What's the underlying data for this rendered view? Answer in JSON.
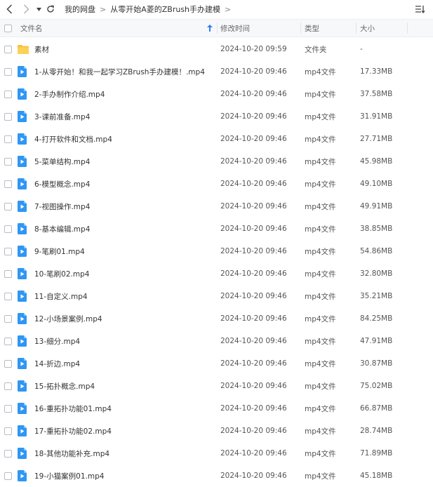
{
  "breadcrumb": {
    "items": [
      "我的网盘",
      "从零开始A菱的ZBrush手办建模"
    ],
    "separator": ">"
  },
  "header": {
    "name": "文件名",
    "modified": "修改时间",
    "type": "类型",
    "size": "大小"
  },
  "colors": {
    "header_bg": "#f7f8fa",
    "sort_arrow": "#2f7df6",
    "folder": "#f7c23f",
    "video_icon": "#2f96f4"
  },
  "files": [
    {
      "name": "素材",
      "modified": "2024-10-20 09:59",
      "type": "文件夹",
      "size": "-",
      "icon": "folder-icon"
    },
    {
      "name": "1-从零开始！和我一起学习ZBrush手办建模！.mp4",
      "modified": "2024-10-20 09:46",
      "type": "mp4文件",
      "size": "17.33MB",
      "icon": "video-file-icon"
    },
    {
      "name": "2-手办制作介绍.mp4",
      "modified": "2024-10-20 09:46",
      "type": "mp4文件",
      "size": "37.58MB",
      "icon": "video-file-icon"
    },
    {
      "name": "3-课前准备.mp4",
      "modified": "2024-10-20 09:46",
      "type": "mp4文件",
      "size": "31.91MB",
      "icon": "video-file-icon"
    },
    {
      "name": "4-打开软件和文档.mp4",
      "modified": "2024-10-20 09:46",
      "type": "mp4文件",
      "size": "27.71MB",
      "icon": "video-file-icon"
    },
    {
      "name": "5-菜单结构.mp4",
      "modified": "2024-10-20 09:46",
      "type": "mp4文件",
      "size": "45.98MB",
      "icon": "video-file-icon"
    },
    {
      "name": "6-模型概念.mp4",
      "modified": "2024-10-20 09:46",
      "type": "mp4文件",
      "size": "49.10MB",
      "icon": "video-file-icon"
    },
    {
      "name": "7-视图操作.mp4",
      "modified": "2024-10-20 09:46",
      "type": "mp4文件",
      "size": "49.91MB",
      "icon": "video-file-icon"
    },
    {
      "name": "8-基本编辑.mp4",
      "modified": "2024-10-20 09:46",
      "type": "mp4文件",
      "size": "38.85MB",
      "icon": "video-file-icon"
    },
    {
      "name": "9-笔刷01.mp4",
      "modified": "2024-10-20 09:46",
      "type": "mp4文件",
      "size": "54.86MB",
      "icon": "video-file-icon"
    },
    {
      "name": "10-笔刷02.mp4",
      "modified": "2024-10-20 09:46",
      "type": "mp4文件",
      "size": "32.80MB",
      "icon": "video-file-icon"
    },
    {
      "name": "11-自定义.mp4",
      "modified": "2024-10-20 09:46",
      "type": "mp4文件",
      "size": "35.21MB",
      "icon": "video-file-icon"
    },
    {
      "name": "12-小场景案例.mp4",
      "modified": "2024-10-20 09:46",
      "type": "mp4文件",
      "size": "84.25MB",
      "icon": "video-file-icon"
    },
    {
      "name": "13-细分.mp4",
      "modified": "2024-10-20 09:46",
      "type": "mp4文件",
      "size": "47.91MB",
      "icon": "video-file-icon"
    },
    {
      "name": "14-折边.mp4",
      "modified": "2024-10-20 09:46",
      "type": "mp4文件",
      "size": "30.87MB",
      "icon": "video-file-icon"
    },
    {
      "name": "15-拓扑概念.mp4",
      "modified": "2024-10-20 09:46",
      "type": "mp4文件",
      "size": "75.02MB",
      "icon": "video-file-icon"
    },
    {
      "name": "16-重拓扑功能01.mp4",
      "modified": "2024-10-20 09:46",
      "type": "mp4文件",
      "size": "66.87MB",
      "icon": "video-file-icon"
    },
    {
      "name": "17-重拓扑功能02.mp4",
      "modified": "2024-10-20 09:46",
      "type": "mp4文件",
      "size": "28.74MB",
      "icon": "video-file-icon"
    },
    {
      "name": "18-其他功能补充.mp4",
      "modified": "2024-10-20 09:46",
      "type": "mp4文件",
      "size": "71.89MB",
      "icon": "video-file-icon"
    },
    {
      "name": "19-小猫案例01.mp4",
      "modified": "2024-10-20 09:46",
      "type": "mp4文件",
      "size": "45.18MB",
      "icon": "video-file-icon"
    }
  ]
}
